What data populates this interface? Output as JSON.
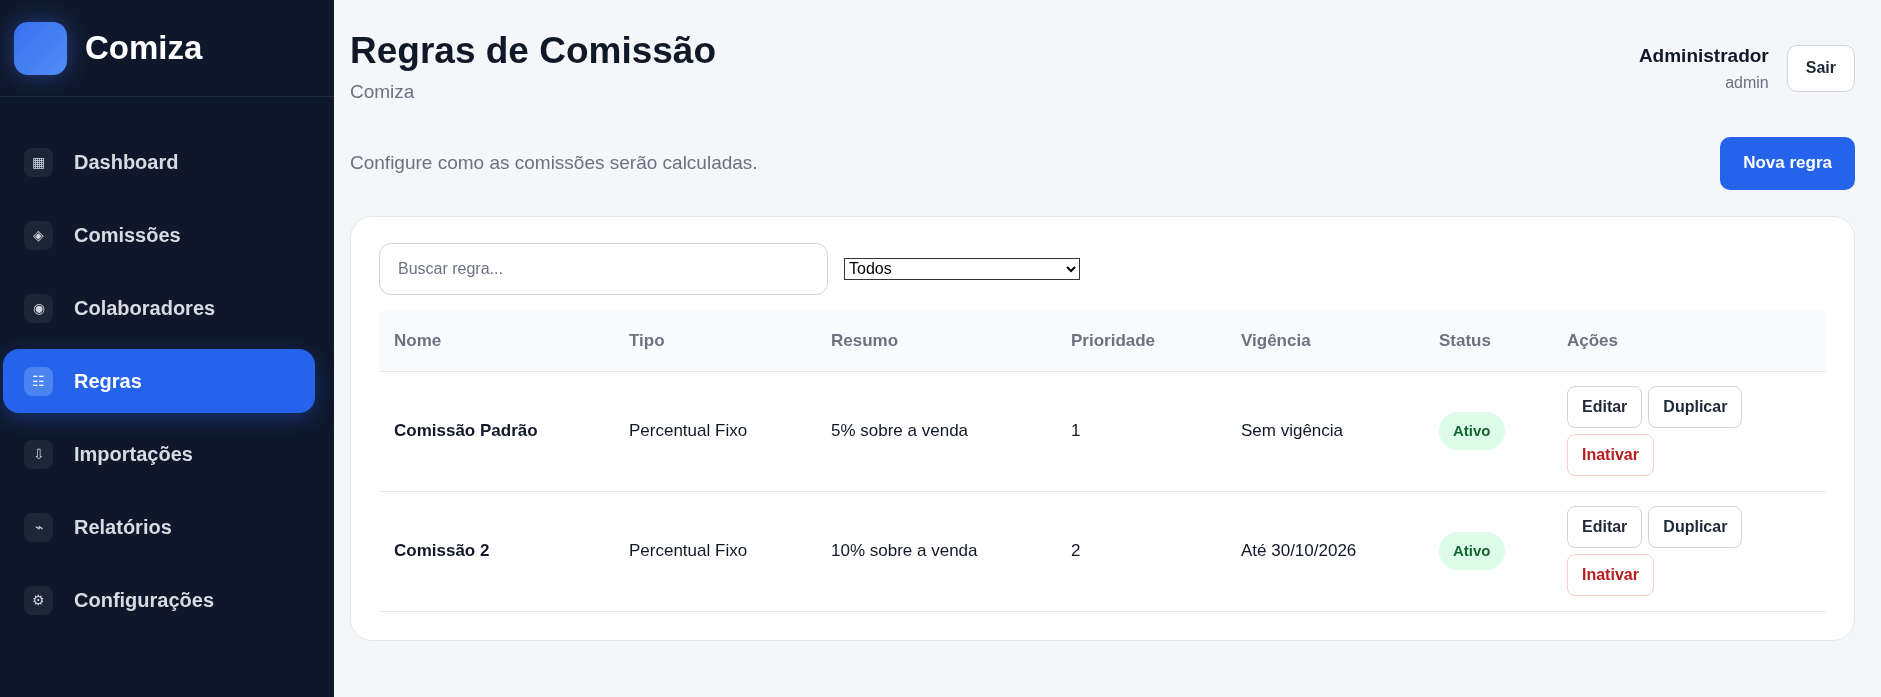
{
  "brand": {
    "name": "Comiza"
  },
  "sidebar": {
    "items": [
      {
        "icon": "▦",
        "label": "Dashboard",
        "selected": false
      },
      {
        "icon": "◈",
        "label": "Comissões",
        "selected": false
      },
      {
        "icon": "◉",
        "label": "Colaboradores",
        "selected": false
      },
      {
        "icon": "☷",
        "label": "Regras",
        "selected": true
      },
      {
        "icon": "⇩",
        "label": "Importações",
        "selected": false
      },
      {
        "icon": "⌁",
        "label": "Relatórios",
        "selected": false
      },
      {
        "icon": "⚙",
        "label": "Configurações",
        "selected": false
      }
    ]
  },
  "header": {
    "title": "Regras de Comissão",
    "subtitle": "Comiza",
    "user": {
      "name": "Administrador",
      "role": "admin"
    },
    "logout": "Sair"
  },
  "intro": "Configure como as comissões serão calculadas.",
  "new_button": "Nova regra",
  "search": {
    "placeholder": "Buscar regra..."
  },
  "filter": {
    "value": "Todos"
  },
  "table": {
    "columns": [
      "Nome",
      "Tipo",
      "Resumo",
      "Prioridade",
      "Vigência",
      "Status",
      "Ações"
    ],
    "rows": [
      {
        "cells": [
          "Comissão Padrão",
          "Percentual Fixo",
          "5% sobre a venda",
          "1",
          "Sem vigência"
        ],
        "status": "Ativo",
        "actions": [
          {
            "label": "Editar",
            "kind": "default"
          },
          {
            "label": "Duplicar",
            "kind": "default"
          },
          {
            "label": "Inativar",
            "kind": "danger"
          }
        ]
      },
      {
        "cells": [
          "Comissão 2",
          "Percentual Fixo",
          "10% sobre a venda",
          "2",
          "Até 30/10/2026"
        ],
        "status": "Ativo",
        "actions": [
          {
            "label": "Editar",
            "kind": "default"
          },
          {
            "label": "Duplicar",
            "kind": "default"
          },
          {
            "label": "Inativar",
            "kind": "danger"
          }
        ]
      }
    ]
  }
}
